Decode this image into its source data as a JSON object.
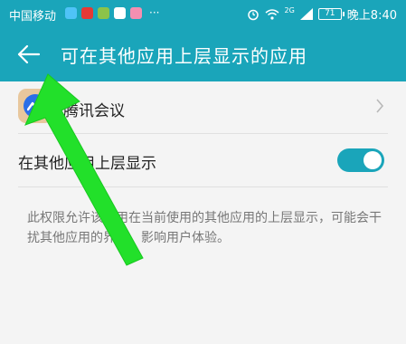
{
  "status_bar": {
    "carrier": "中国移动",
    "network": "2G",
    "battery": "71",
    "time": "晚上8:40",
    "more": "···",
    "app_icons": [
      "app-1",
      "app-2",
      "app-3",
      "app-4",
      "app-5"
    ]
  },
  "header": {
    "title": "可在其他应用上层显示的应用",
    "back_icon": "back-arrow-icon"
  },
  "app": {
    "name": "腾讯会议",
    "chevron_icon": "chevron-right-icon"
  },
  "setting": {
    "label": "在其他应用上层显示",
    "enabled": true
  },
  "description": "此权限允许该应用在当前使用的其他应用的上层显示，可能会干扰其他应用的界面，影响用户体验。",
  "colors": {
    "accent": "#1aa5ba",
    "annotation_arrow": "#22e02a"
  }
}
